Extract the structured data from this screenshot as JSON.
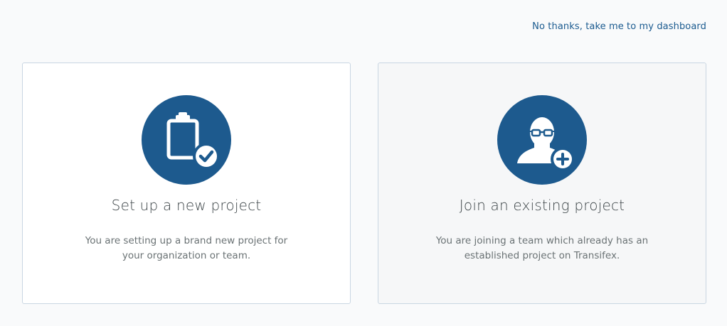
{
  "header": {
    "skip_link": "No thanks, take me to my dashboard"
  },
  "options": [
    {
      "icon": "clipboard-check-icon",
      "title": "Set up a new project",
      "description": "You are setting up a brand new project for your organization or team."
    },
    {
      "icon": "user-add-icon",
      "title": "Join an existing project",
      "description": "You are joining a team which already has an established project on Transifex."
    }
  ],
  "colors": {
    "accent": "#1d5a8e",
    "link": "#1a5a8f",
    "background": "#f9fafb",
    "card_border": "#c9d6e2"
  }
}
